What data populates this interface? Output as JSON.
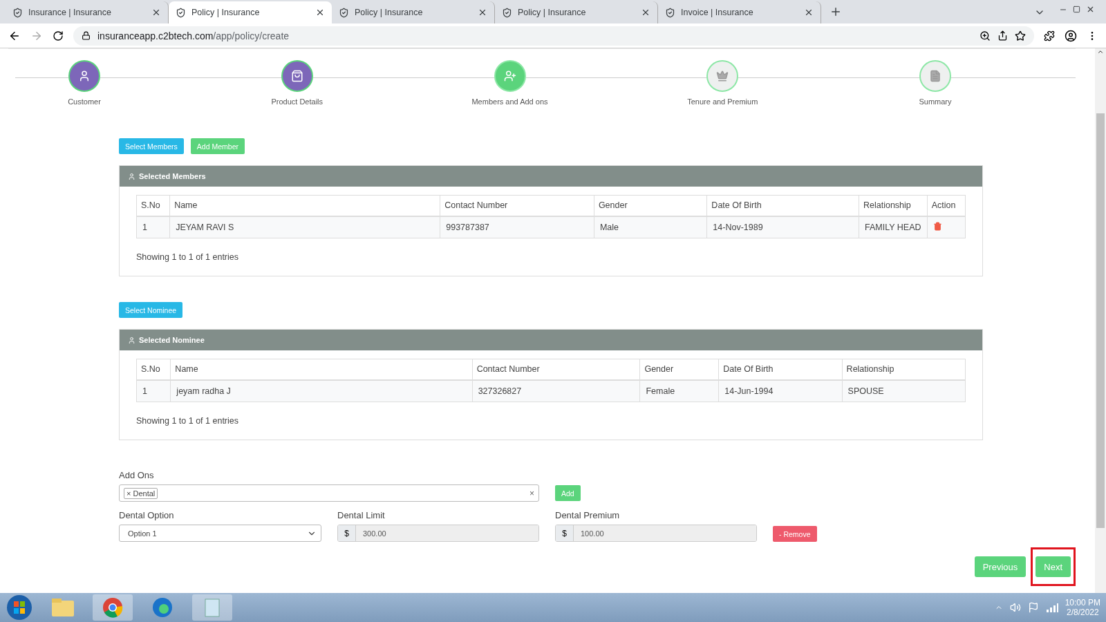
{
  "browser": {
    "tabs": [
      {
        "title": "Insurance | Insurance",
        "selected": false
      },
      {
        "title": "Policy | Insurance",
        "selected": true
      },
      {
        "title": "Policy | Insurance",
        "selected": false
      },
      {
        "title": "Policy | Insurance",
        "selected": false
      },
      {
        "title": "Invoice | Insurance",
        "selected": false
      }
    ],
    "url_host": "insuranceapp.c2btech.com",
    "url_path": "/app/policy/create"
  },
  "stepper": {
    "steps": [
      {
        "label": "Customer",
        "kind": "done"
      },
      {
        "label": "Product Details",
        "kind": "done"
      },
      {
        "label": "Members and Add ons",
        "kind": "current"
      },
      {
        "label": "Tenure and Premium",
        "kind": "pending"
      },
      {
        "label": "Summary",
        "kind": "pending"
      }
    ]
  },
  "members": {
    "buttons": [
      {
        "label": "Select Members",
        "kind": "info"
      },
      {
        "label": "Add Member",
        "kind": "success"
      }
    ],
    "panel_title": "Selected Members",
    "columns": [
      "S.No",
      "Name",
      "Contact Number",
      "Gender",
      "Date Of Birth",
      "Relationship",
      "Action"
    ],
    "rows": [
      {
        "cells": [
          "1",
          "JEYAM RAVI S",
          "993787387",
          "Male",
          "14-Nov-1989",
          "FAMILY HEAD"
        ],
        "deletable": true
      }
    ],
    "info": "Showing 1 to 1 of 1 entries"
  },
  "nominee": {
    "buttons": [
      {
        "label": "Select Nominee",
        "kind": "info"
      }
    ],
    "panel_title": "Selected Nominee",
    "columns": [
      "S.No",
      "Name",
      "Contact Number",
      "Gender",
      "Date Of Birth",
      "Relationship"
    ],
    "rows": [
      {
        "cells": [
          "1",
          "jeyam radha J",
          "327326827",
          "Female",
          "14-Jun-1994",
          "SPOUSE"
        ],
        "deletable": false
      }
    ],
    "info": "Showing 1 to 1 of 1 entries"
  },
  "add_ons": {
    "label": "Add Ons",
    "tags": [
      "Dental"
    ],
    "clear": "×",
    "tag_remove": "×",
    "add_button": "Add",
    "option_label": "Dental Option",
    "option_value": "Option 1",
    "limit_label": "Dental Limit",
    "limit_prefix": "$",
    "limit_value": "300.00",
    "premium_label": "Dental Premium",
    "premium_prefix": "$",
    "premium_value": "100.00",
    "remove_button": "- Remove"
  },
  "footer_buttons": [
    {
      "label": "Previous",
      "highlighted": false
    },
    {
      "label": "Next",
      "highlighted": true
    }
  ],
  "taskbar": {
    "time": "10:00 PM",
    "date": "2/8/2022"
  }
}
